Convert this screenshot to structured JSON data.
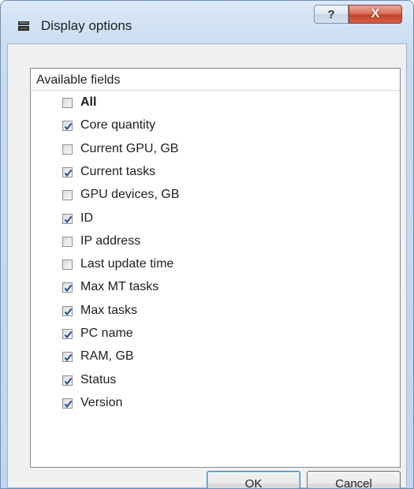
{
  "window": {
    "title": "Display options",
    "help_glyph": "?",
    "close_glyph": "X"
  },
  "list": {
    "header": "Available fields",
    "items": [
      {
        "label": "All",
        "checked": false,
        "bold": true
      },
      {
        "label": "Core quantity",
        "checked": true
      },
      {
        "label": "Current GPU, GB",
        "checked": false
      },
      {
        "label": "Current tasks",
        "checked": true
      },
      {
        "label": "GPU devices, GB",
        "checked": false
      },
      {
        "label": "ID",
        "checked": true
      },
      {
        "label": "IP address",
        "checked": false
      },
      {
        "label": "Last update time",
        "checked": false
      },
      {
        "label": "Max MT tasks",
        "checked": true
      },
      {
        "label": "Max tasks",
        "checked": true
      },
      {
        "label": "PC name",
        "checked": true
      },
      {
        "label": "RAM, GB",
        "checked": true
      },
      {
        "label": "Status",
        "checked": true
      },
      {
        "label": "Version",
        "checked": true
      }
    ]
  },
  "buttons": {
    "ok": "OK",
    "cancel": "Cancel"
  },
  "icons": {
    "app": "app-icon",
    "help": "help-icon",
    "close": "close-icon",
    "checkbox_check": "checkmark-icon"
  },
  "colors": {
    "check": "#1f4e96",
    "close_button": "#c7432b"
  }
}
